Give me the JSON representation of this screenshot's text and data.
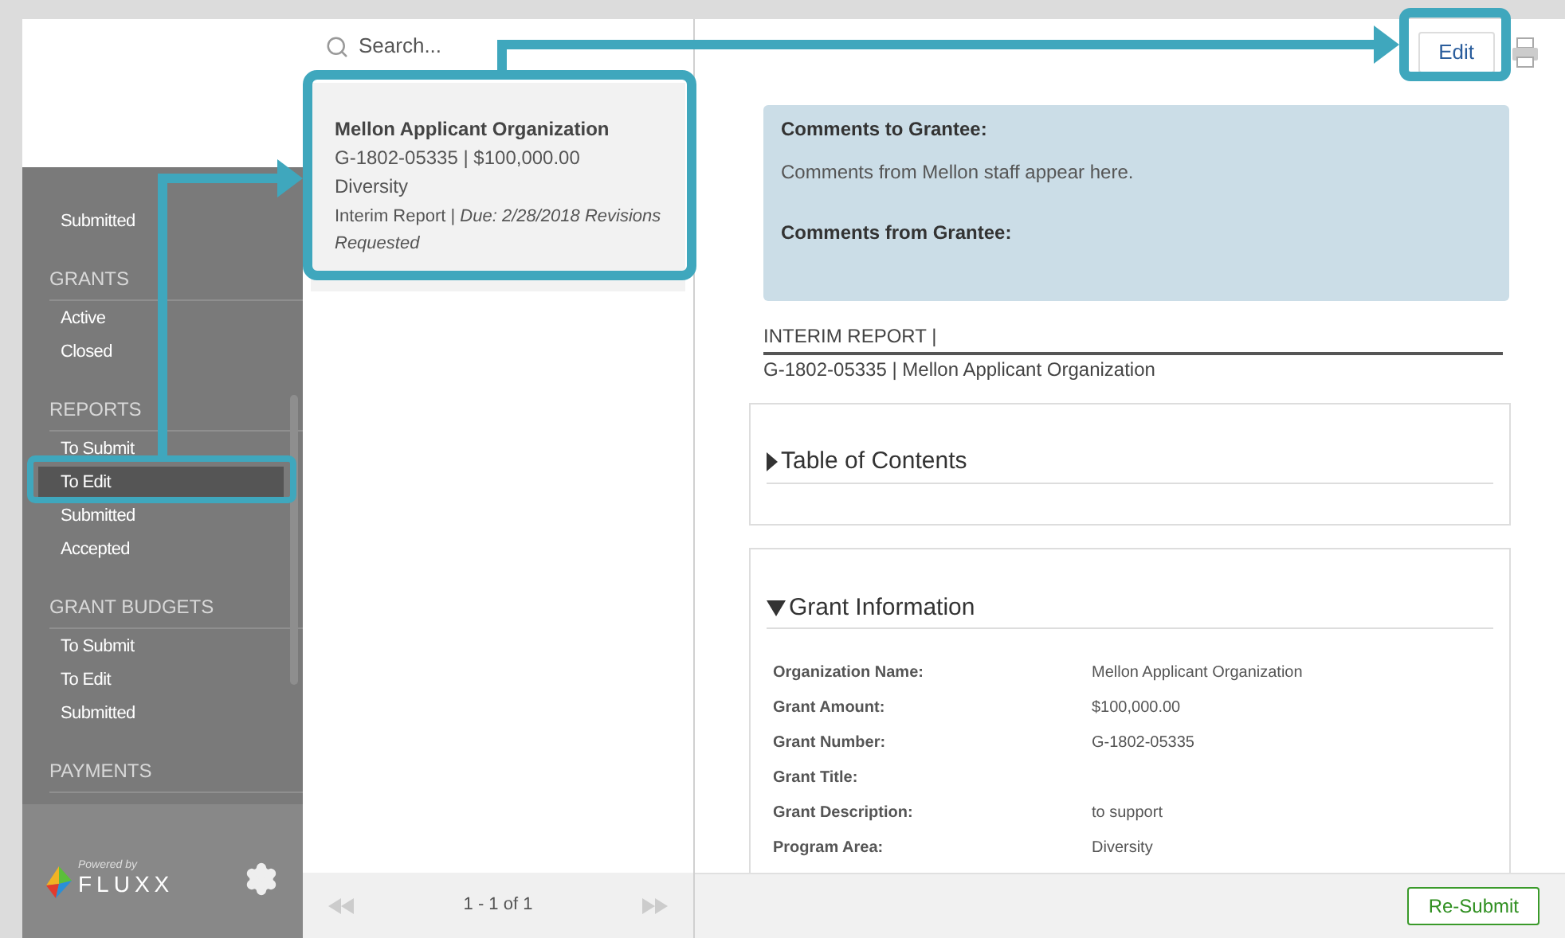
{
  "sidebar": {
    "sections": [
      {
        "items": [
          {
            "label": "Submitted",
            "selected": false
          }
        ]
      },
      {
        "title": "GRANTS",
        "items": [
          {
            "label": "Active",
            "selected": false
          },
          {
            "label": "Closed",
            "selected": false
          }
        ]
      },
      {
        "title": "REPORTS",
        "items": [
          {
            "label": "To Submit",
            "selected": false
          },
          {
            "label": "To Edit",
            "selected": true
          },
          {
            "label": "Submitted",
            "selected": false
          },
          {
            "label": "Accepted",
            "selected": false
          }
        ]
      },
      {
        "title": "GRANT BUDGETS",
        "items": [
          {
            "label": "To Submit",
            "selected": false
          },
          {
            "label": "To Edit",
            "selected": false
          },
          {
            "label": "Submitted",
            "selected": false
          }
        ]
      },
      {
        "title": "PAYMENTS"
      }
    ],
    "footer": {
      "powered_by": "Powered by",
      "brand": "FLUXX"
    }
  },
  "list": {
    "search": {
      "placeholder": "Search..."
    },
    "cards": [
      {
        "title": "Mellon Applicant Organization",
        "line_1": "G-1802-05335 | $100,000.00",
        "line_2": "Diversity",
        "status": "Interim Report | *Due: 2/28/2018 Revisions Requested*",
        "selected": true
      }
    ],
    "pager": {
      "text": "1 - 1 of 1"
    }
  },
  "detail": {
    "edit_button": "Edit",
    "comments": {
      "to_label": "Comments to Grantee:",
      "to_text": "Comments from Mellon staff appear here.",
      "from_label": "Comments from Grantee:"
    },
    "report": {
      "heading": "INTERIM REPORT |",
      "subheading": "G-1802-05335 | Mellon Applicant Organization"
    },
    "sections": [
      {
        "title": "Table of Contents",
        "expanded": false
      },
      {
        "title": "Grant Information",
        "expanded": true,
        "fields": [
          {
            "label": "Organization Name:",
            "value": "Mellon Applicant Organization"
          },
          {
            "label": "Grant Amount:",
            "value": "$100,000.00"
          },
          {
            "label": "Grant Number:",
            "value": "G-1802-05335"
          },
          {
            "label": "Grant Title:"
          },
          {
            "label": "Grant Description:",
            "value": "to support"
          },
          {
            "label": "Program Area:",
            "value": "Diversity"
          }
        ]
      }
    ],
    "resubmit_button": "Re-Submit"
  }
}
